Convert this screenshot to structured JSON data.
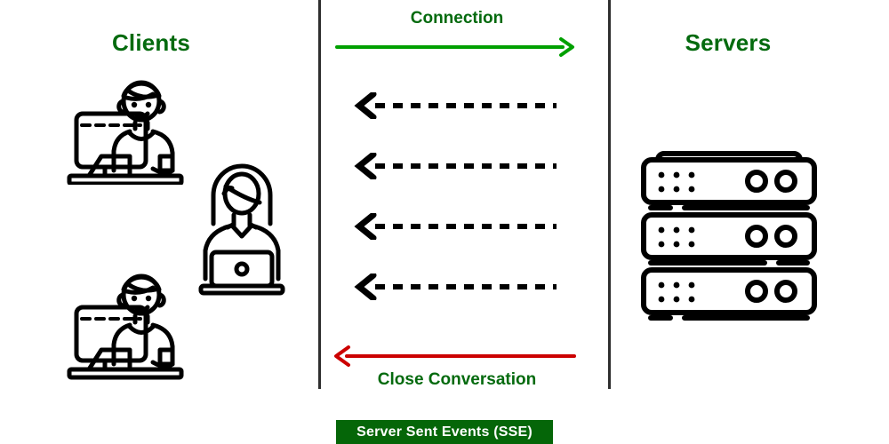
{
  "diagram": {
    "title": "Server Sent Events (SSE)",
    "columns": {
      "left_heading": "Clients",
      "right_heading": "Servers"
    },
    "channel": {
      "top_label": "Connection",
      "bottom_label": "Close Conversation"
    },
    "colors": {
      "heading_green": "#046a0e",
      "connection_arrow_green": "#00a000",
      "close_arrow_red": "#cc0000",
      "banner_green": "#056608",
      "banner_text": "#ffffff",
      "stroke_black": "#000000",
      "divider_gray": "#2e2e2e"
    },
    "arrows": {
      "connection": {
        "name": "connection-arrow",
        "direction": "right",
        "color": "#00a000",
        "style": "solid"
      },
      "events": [
        {
          "name": "event-stream-arrow-1",
          "direction": "left",
          "color": "#000000",
          "style": "dashed"
        },
        {
          "name": "event-stream-arrow-2",
          "direction": "left",
          "color": "#000000",
          "style": "dashed"
        },
        {
          "name": "event-stream-arrow-3",
          "direction": "left",
          "color": "#000000",
          "style": "dashed"
        },
        {
          "name": "event-stream-arrow-4",
          "direction": "left",
          "color": "#000000",
          "style": "dashed"
        }
      ],
      "close": {
        "name": "close-conversation-arrow",
        "direction": "left",
        "color": "#cc0000",
        "style": "solid"
      }
    },
    "icons": {
      "client_desktop_top": "person-at-desktop-computer-icon",
      "client_desktop_bottom": "person-at-desktop-computer-icon",
      "client_laptop": "woman-with-laptop-icon",
      "servers": "server-rack-stack-icon",
      "server_units": 3
    }
  }
}
